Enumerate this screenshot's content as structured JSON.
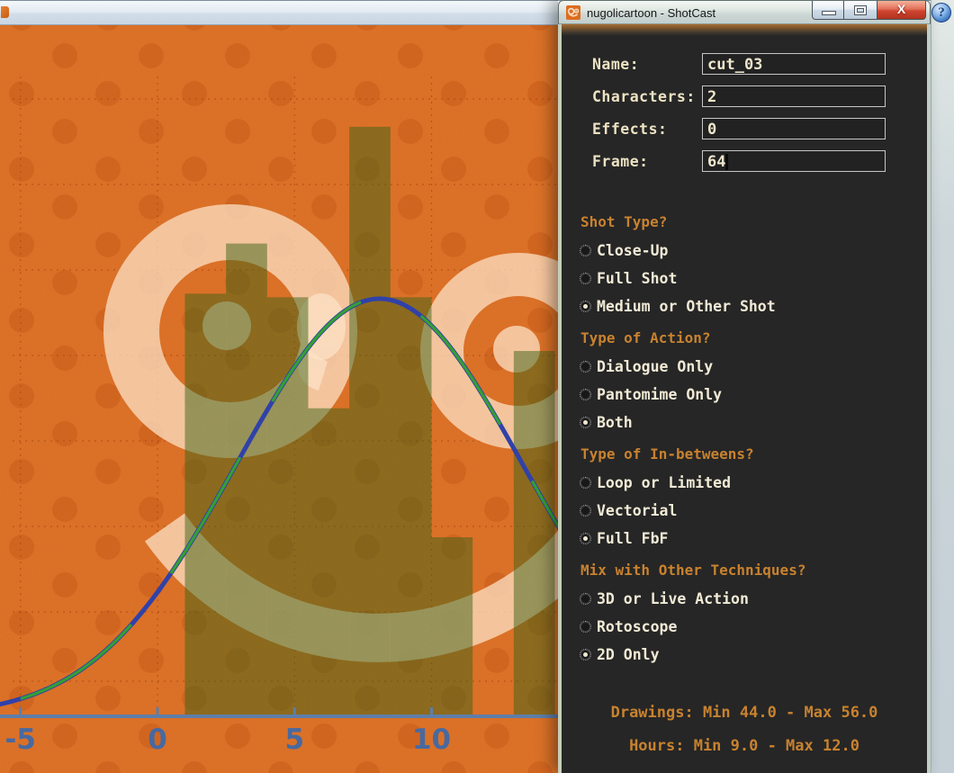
{
  "background_window": {
    "help_label": "?"
  },
  "dialog": {
    "title": "nugolicartoon - ShotCast",
    "window_buttons": {
      "minimize": "minimize",
      "maximize": "maximize",
      "close_glyph": "X"
    },
    "fields": [
      {
        "label": "Name:",
        "value": "cut_03",
        "caret": false
      },
      {
        "label": "Characters:",
        "value": "2",
        "caret": false
      },
      {
        "label": "Effects:",
        "value": "0",
        "caret": false
      },
      {
        "label": "Frame:",
        "value": "64",
        "caret": true
      }
    ],
    "sections": [
      {
        "title": "Shot Type?",
        "options": [
          {
            "label": "Close-Up",
            "selected": false
          },
          {
            "label": "Full Shot",
            "selected": false
          },
          {
            "label": "Medium or Other Shot",
            "selected": true
          }
        ]
      },
      {
        "title": "Type of Action?",
        "options": [
          {
            "label": "Dialogue Only",
            "selected": false
          },
          {
            "label": "Pantomime Only",
            "selected": false
          },
          {
            "label": "Both",
            "selected": true
          }
        ]
      },
      {
        "title": "Type of In-betweens?",
        "options": [
          {
            "label": "Loop or Limited",
            "selected": false
          },
          {
            "label": "Vectorial",
            "selected": false
          },
          {
            "label": "Full FbF",
            "selected": true
          }
        ]
      },
      {
        "title": "Mix with Other Techniques?",
        "options": [
          {
            "label": "3D or Live Action",
            "selected": false
          },
          {
            "label": "Rotoscope",
            "selected": false
          },
          {
            "label": "2D Only",
            "selected": true
          }
        ]
      }
    ],
    "footer": [
      "Drawings: Min 44.0 - Max 56.0",
      "Hours: Min 9.0 - Max 12.0"
    ]
  },
  "chart_data": {
    "type": "bar",
    "title": "",
    "xlabel": "",
    "ylabel": "",
    "x_ticks": [
      -5,
      0,
      5,
      10
    ],
    "x_range": [
      -5.8,
      29.1
    ],
    "grid": true,
    "bars": [
      {
        "x0": 1.0,
        "x1": 2.5,
        "h": 0.59
      },
      {
        "x0": 2.5,
        "x1": 4.0,
        "h": 0.66
      },
      {
        "x0": 4.0,
        "x1": 5.5,
        "h": 0.585
      },
      {
        "x0": 5.5,
        "x1": 7.0,
        "h": 0.43
      },
      {
        "x0": 7.0,
        "x1": 8.5,
        "h": 0.823
      },
      {
        "x0": 8.5,
        "x1": 10.0,
        "h": 0.585
      },
      {
        "x0": 10.0,
        "x1": 11.5,
        "h": 0.25
      },
      {
        "x0": 11.5,
        "x1": 13.0,
        "h": 0.0
      },
      {
        "x0": 13.0,
        "x1": 14.5,
        "h": 0.51
      }
    ],
    "curve": {
      "shape": "gaussian",
      "mean": 8.1,
      "sigma": 5.2,
      "peak": 0.583
    },
    "colors": {
      "background": "#dc6e22",
      "polka_dot": "rgba(198,85,18,0.5)",
      "gridline": "rgba(158,62,8,0.6)",
      "watermark": "rgba(255,228,200,0.74)",
      "bar": "rgba(55,95,15,0.5)",
      "curve_blue": "#2b3da8",
      "curve_green": "#2f9e2f",
      "axis": "#5b7ca8",
      "tick_label": "#44669f"
    }
  }
}
